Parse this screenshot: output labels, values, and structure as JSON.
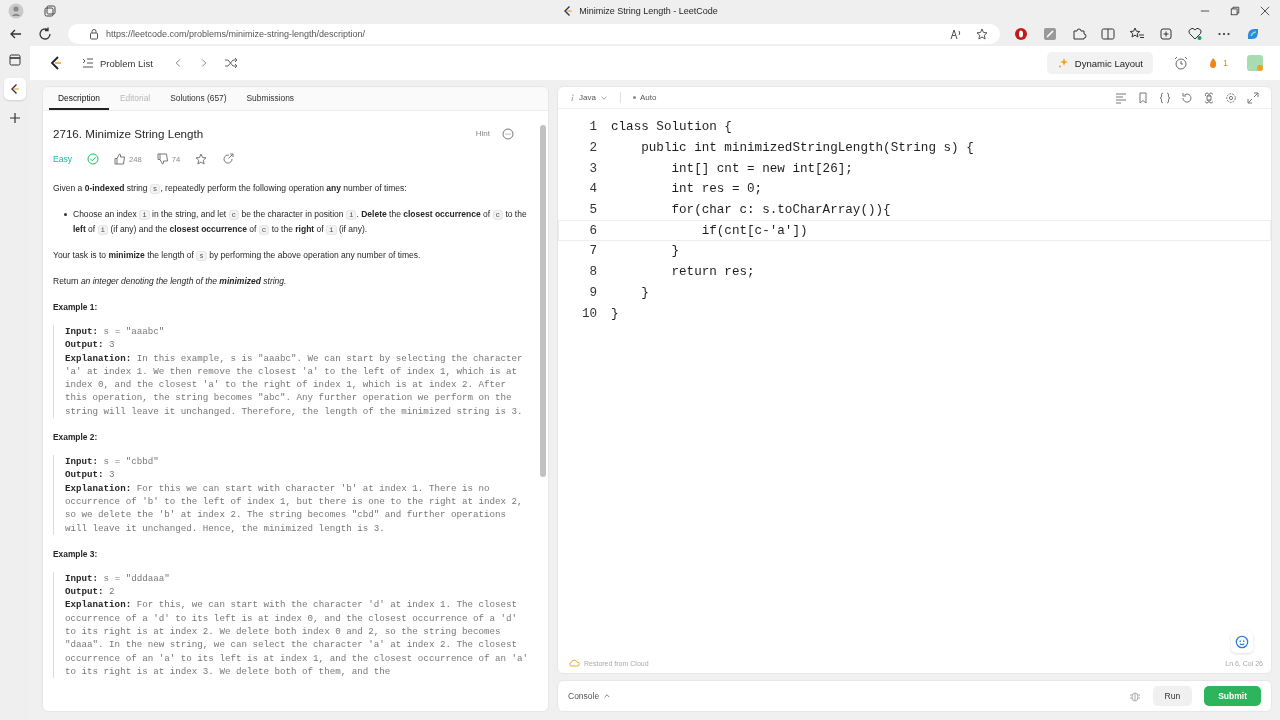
{
  "browser": {
    "title": "Minimize String Length - LeetCode",
    "url": "https://leetcode.com/problems/minimize-string-length/description/"
  },
  "nav": {
    "problem_list": "Problem List",
    "dynamic_layout": "Dynamic Layout",
    "streak": "1"
  },
  "tabs": [
    {
      "label": "Description",
      "selected": true,
      "disabled": false
    },
    {
      "label": "Editorial",
      "selected": false,
      "disabled": true
    },
    {
      "label": "Solutions (657)",
      "selected": false,
      "disabled": false
    },
    {
      "label": "Submissions",
      "selected": false,
      "disabled": false
    }
  ],
  "problem": {
    "title": "2716. Minimize String Length",
    "hint": "Hint",
    "difficulty": "Easy",
    "solved": true,
    "likes": "248",
    "dislikes": "74"
  },
  "description": [
    {
      "kind": "para",
      "parts": [
        {
          "kind": "text",
          "text": "Given a **0-indexed** string "
        },
        {
          "kind": "code",
          "text": "s"
        },
        {
          "kind": "text",
          "text": ", repeatedly perform the following operation **any** number of times:"
        }
      ]
    },
    {
      "kind": "bullet",
      "parts": [
        {
          "kind": "text",
          "text": "Choose an index "
        },
        {
          "kind": "code",
          "text": "i"
        },
        {
          "kind": "text",
          "text": " in the string, and let "
        },
        {
          "kind": "code",
          "text": "c"
        },
        {
          "kind": "text",
          "text": " be the character in position "
        },
        {
          "kind": "code",
          "text": "i"
        },
        {
          "kind": "text",
          "text": ". **Delete** the **closest occurrence** of "
        },
        {
          "kind": "code",
          "text": "c"
        },
        {
          "kind": "text",
          "text": " to the **left** of "
        },
        {
          "kind": "code",
          "text": "i"
        },
        {
          "kind": "text",
          "text": " (if any) and the **closest occurrence** of "
        },
        {
          "kind": "code",
          "text": "c"
        },
        {
          "kind": "text",
          "text": " to the **right** of "
        },
        {
          "kind": "code",
          "text": "i"
        },
        {
          "kind": "text",
          "text": " (if any)."
        }
      ]
    },
    {
      "kind": "para",
      "parts": [
        {
          "kind": "text",
          "text": "Your task is to **minimize** the length of "
        },
        {
          "kind": "code",
          "text": "s"
        },
        {
          "kind": "text",
          "text": " by performing the above operation any number of times."
        }
      ]
    },
    {
      "kind": "para",
      "parts": [
        {
          "kind": "text",
          "text": "Return "
        },
        {
          "kind": "em",
          "text": "an integer denoting the length of the **minimized** string."
        }
      ]
    }
  ],
  "examples": [
    {
      "title": "Example 1:",
      "lines": [
        {
          "label": "Input:",
          "value": "s = \"aaabc\""
        },
        {
          "label": "Output:",
          "value": "3"
        },
        {
          "label": "Explanation:",
          "value": "In this example, s is \"aaabc\". We can start by selecting the character 'a' at index 1. We then remove the closest 'a' to the left of index 1, which is at index 0, and the closest 'a' to the right of index 1, which is at index 2. After this operation, the string becomes \"abc\". Any further operation we perform on the string will leave it unchanged. Therefore, the length of the minimized string is 3."
        }
      ]
    },
    {
      "title": "Example 2:",
      "lines": [
        {
          "label": "Input:",
          "value": "s = \"cbbd\""
        },
        {
          "label": "Output:",
          "value": "3"
        },
        {
          "label": "Explanation:",
          "value": "For this we can start with character 'b' at index 1. There is no occurrence of 'b' to the left of index 1, but there is one to the right at index 2, so we delete the 'b' at index 2. The string becomes \"cbd\" and further operations will leave it unchanged. Hence, the minimized length is 3."
        }
      ]
    },
    {
      "title": "Example 3:",
      "lines": [
        {
          "label": "Input:",
          "value": "s = \"dddaaa\""
        },
        {
          "label": "Output:",
          "value": "2"
        },
        {
          "label": "Explanation:",
          "value": "For this, we can start with the character 'd' at index 1. The closest occurrence of a 'd' to its left is at index 0, and the closest occurrence of a 'd' to its right is at index 2. We delete both index 0 and 2, so the string becomes \"daaa\". In the new string, we can select the character 'a' at index 2. The closest occurrence of an 'a' to its left is at index 1, and the closest occurrence of an 'a' to its right is at index 3. We delete both of them, and the"
        }
      ]
    }
  ],
  "editor": {
    "language": "Java",
    "mode": "Auto",
    "status": "Restored from Cloud",
    "position": "Ln 6, Col 26",
    "lines": [
      {
        "number": "1",
        "code": "class Solution {",
        "current": false
      },
      {
        "number": "2",
        "code": "    public int minimizedStringLength(String s) {",
        "current": false
      },
      {
        "number": "3",
        "code": "        int[] cnt = new int[26];",
        "current": false
      },
      {
        "number": "4",
        "code": "        int res = 0;",
        "current": false
      },
      {
        "number": "5",
        "code": "        for(char c: s.toCharArray()){",
        "current": false
      },
      {
        "number": "6",
        "code": "            if(cnt[c-'a'])",
        "current": true
      },
      {
        "number": "7",
        "code": "        }",
        "current": false
      },
      {
        "number": "8",
        "code": "        return res;",
        "current": false
      },
      {
        "number": "9",
        "code": "    }",
        "current": false
      },
      {
        "number": "10",
        "code": "}",
        "current": false
      }
    ]
  },
  "console": {
    "label": "Console",
    "run": "Run",
    "submit": "Submit"
  }
}
